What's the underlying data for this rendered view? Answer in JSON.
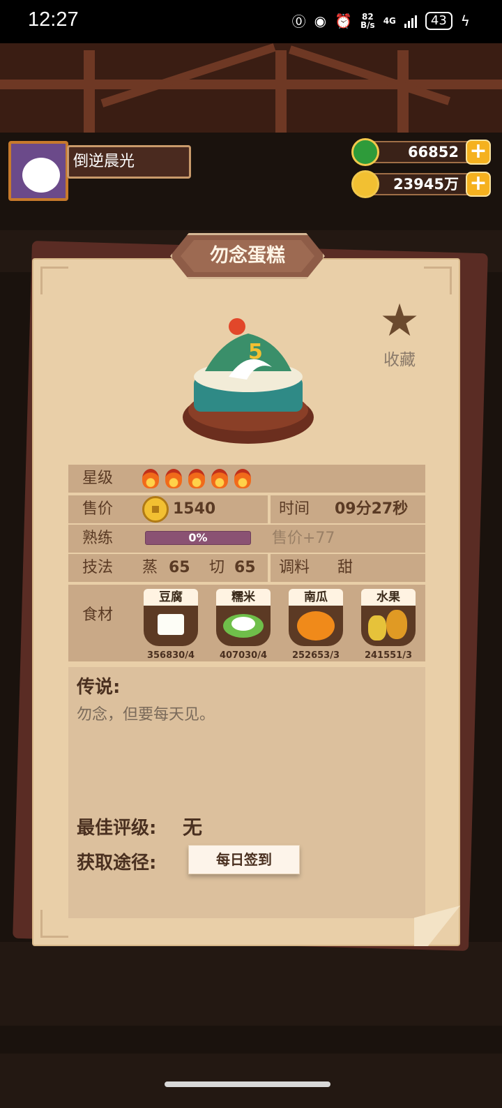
{
  "status_bar": {
    "time": "12:27",
    "net_speed_value": "82",
    "net_speed_unit": "B/s",
    "network": "4G",
    "battery": "43"
  },
  "player": {
    "name": "倒逆晨光"
  },
  "currencies": {
    "jade": "66852",
    "coins": "23945万"
  },
  "dish": {
    "title": "勿念蛋糕",
    "favorite_label": "收藏",
    "star_level": 5,
    "rows": {
      "stars_label": "星级",
      "price_label": "售价",
      "price_value": "1540",
      "time_label": "时间",
      "time_value": "09分27秒",
      "skill_label": "熟练",
      "skill_progress": "0%",
      "skill_bonus": "售价+77",
      "technique_label": "技法",
      "technique_1_name": "蒸",
      "technique_1_value": "65",
      "technique_2_name": "切",
      "technique_2_value": "65",
      "seasoning_label": "调料",
      "seasoning_value": "甜"
    },
    "ingredients_label": "食材",
    "ingredients": [
      {
        "name": "豆腐",
        "count": "356830/4"
      },
      {
        "name": "糯米",
        "count": "407030/4"
      },
      {
        "name": "南瓜",
        "count": "252653/3"
      },
      {
        "name": "水果",
        "count": "241551/3"
      }
    ],
    "legend_title": "传说:",
    "legend_text": "勿念，但要每天见。",
    "best_rating_label": "最佳评级:",
    "best_rating_value": "无",
    "source_label": "获取途径:",
    "source_button": "每日签到"
  }
}
